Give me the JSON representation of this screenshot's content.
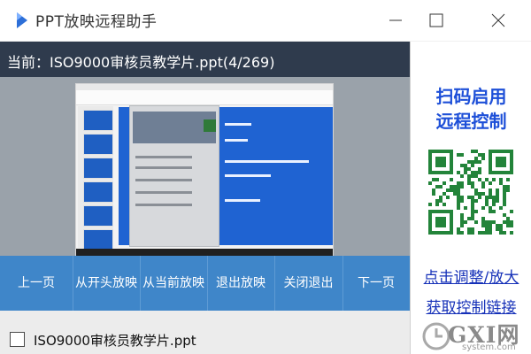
{
  "window": {
    "title": "PPT放映远程助手",
    "accent": "#3f86c9",
    "header_bg": "#2f3b4d"
  },
  "current": {
    "label": "当前：ISO9000审核员教学片.ppt(4/269)"
  },
  "controls": [
    {
      "label": "上一页",
      "icon": ""
    },
    {
      "label": "从开头放映",
      "icon": ""
    },
    {
      "label": "从当前放映",
      "icon": ""
    },
    {
      "label": "退出放映",
      "icon": ""
    },
    {
      "label": "关闭退出",
      "icon": ""
    },
    {
      "label": "下一页",
      "icon": ""
    }
  ],
  "file_list": [
    {
      "name": "ISO9000审核员教学片.ppt",
      "checked": false
    }
  ],
  "right_panel": {
    "scan_title_line1": "扫码启用",
    "scan_title_line2": "远程控制",
    "link_adjust": "点击调整/放大",
    "link_get": "获取控制链接",
    "qr_color": "#23843a"
  },
  "watermark": {
    "brand": "GXI网",
    "site": "system.com"
  }
}
